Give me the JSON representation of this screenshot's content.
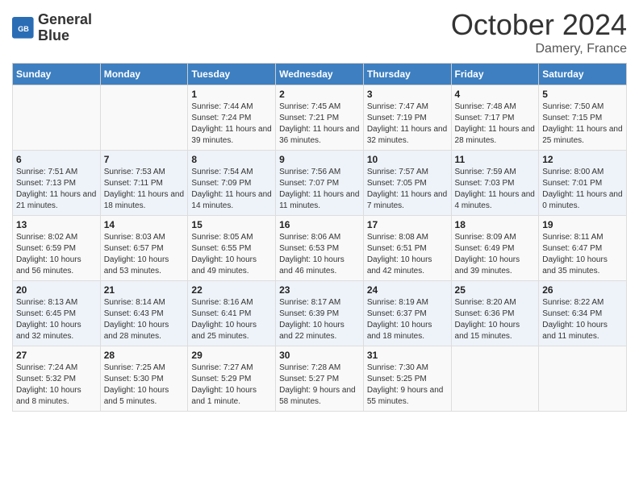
{
  "header": {
    "logo_line1": "General",
    "logo_line2": "Blue",
    "month": "October 2024",
    "location": "Damery, France"
  },
  "days_of_week": [
    "Sunday",
    "Monday",
    "Tuesday",
    "Wednesday",
    "Thursday",
    "Friday",
    "Saturday"
  ],
  "weeks": [
    [
      {
        "day": "",
        "content": ""
      },
      {
        "day": "",
        "content": ""
      },
      {
        "day": "1",
        "content": "Sunrise: 7:44 AM\nSunset: 7:24 PM\nDaylight: 11 hours and 39 minutes."
      },
      {
        "day": "2",
        "content": "Sunrise: 7:45 AM\nSunset: 7:21 PM\nDaylight: 11 hours and 36 minutes."
      },
      {
        "day": "3",
        "content": "Sunrise: 7:47 AM\nSunset: 7:19 PM\nDaylight: 11 hours and 32 minutes."
      },
      {
        "day": "4",
        "content": "Sunrise: 7:48 AM\nSunset: 7:17 PM\nDaylight: 11 hours and 28 minutes."
      },
      {
        "day": "5",
        "content": "Sunrise: 7:50 AM\nSunset: 7:15 PM\nDaylight: 11 hours and 25 minutes."
      }
    ],
    [
      {
        "day": "6",
        "content": "Sunrise: 7:51 AM\nSunset: 7:13 PM\nDaylight: 11 hours and 21 minutes."
      },
      {
        "day": "7",
        "content": "Sunrise: 7:53 AM\nSunset: 7:11 PM\nDaylight: 11 hours and 18 minutes."
      },
      {
        "day": "8",
        "content": "Sunrise: 7:54 AM\nSunset: 7:09 PM\nDaylight: 11 hours and 14 minutes."
      },
      {
        "day": "9",
        "content": "Sunrise: 7:56 AM\nSunset: 7:07 PM\nDaylight: 11 hours and 11 minutes."
      },
      {
        "day": "10",
        "content": "Sunrise: 7:57 AM\nSunset: 7:05 PM\nDaylight: 11 hours and 7 minutes."
      },
      {
        "day": "11",
        "content": "Sunrise: 7:59 AM\nSunset: 7:03 PM\nDaylight: 11 hours and 4 minutes."
      },
      {
        "day": "12",
        "content": "Sunrise: 8:00 AM\nSunset: 7:01 PM\nDaylight: 11 hours and 0 minutes."
      }
    ],
    [
      {
        "day": "13",
        "content": "Sunrise: 8:02 AM\nSunset: 6:59 PM\nDaylight: 10 hours and 56 minutes."
      },
      {
        "day": "14",
        "content": "Sunrise: 8:03 AM\nSunset: 6:57 PM\nDaylight: 10 hours and 53 minutes."
      },
      {
        "day": "15",
        "content": "Sunrise: 8:05 AM\nSunset: 6:55 PM\nDaylight: 10 hours and 49 minutes."
      },
      {
        "day": "16",
        "content": "Sunrise: 8:06 AM\nSunset: 6:53 PM\nDaylight: 10 hours and 46 minutes."
      },
      {
        "day": "17",
        "content": "Sunrise: 8:08 AM\nSunset: 6:51 PM\nDaylight: 10 hours and 42 minutes."
      },
      {
        "day": "18",
        "content": "Sunrise: 8:09 AM\nSunset: 6:49 PM\nDaylight: 10 hours and 39 minutes."
      },
      {
        "day": "19",
        "content": "Sunrise: 8:11 AM\nSunset: 6:47 PM\nDaylight: 10 hours and 35 minutes."
      }
    ],
    [
      {
        "day": "20",
        "content": "Sunrise: 8:13 AM\nSunset: 6:45 PM\nDaylight: 10 hours and 32 minutes."
      },
      {
        "day": "21",
        "content": "Sunrise: 8:14 AM\nSunset: 6:43 PM\nDaylight: 10 hours and 28 minutes."
      },
      {
        "day": "22",
        "content": "Sunrise: 8:16 AM\nSunset: 6:41 PM\nDaylight: 10 hours and 25 minutes."
      },
      {
        "day": "23",
        "content": "Sunrise: 8:17 AM\nSunset: 6:39 PM\nDaylight: 10 hours and 22 minutes."
      },
      {
        "day": "24",
        "content": "Sunrise: 8:19 AM\nSunset: 6:37 PM\nDaylight: 10 hours and 18 minutes."
      },
      {
        "day": "25",
        "content": "Sunrise: 8:20 AM\nSunset: 6:36 PM\nDaylight: 10 hours and 15 minutes."
      },
      {
        "day": "26",
        "content": "Sunrise: 8:22 AM\nSunset: 6:34 PM\nDaylight: 10 hours and 11 minutes."
      }
    ],
    [
      {
        "day": "27",
        "content": "Sunrise: 7:24 AM\nSunset: 5:32 PM\nDaylight: 10 hours and 8 minutes."
      },
      {
        "day": "28",
        "content": "Sunrise: 7:25 AM\nSunset: 5:30 PM\nDaylight: 10 hours and 5 minutes."
      },
      {
        "day": "29",
        "content": "Sunrise: 7:27 AM\nSunset: 5:29 PM\nDaylight: 10 hours and 1 minute."
      },
      {
        "day": "30",
        "content": "Sunrise: 7:28 AM\nSunset: 5:27 PM\nDaylight: 9 hours and 58 minutes."
      },
      {
        "day": "31",
        "content": "Sunrise: 7:30 AM\nSunset: 5:25 PM\nDaylight: 9 hours and 55 minutes."
      },
      {
        "day": "",
        "content": ""
      },
      {
        "day": "",
        "content": ""
      }
    ]
  ]
}
